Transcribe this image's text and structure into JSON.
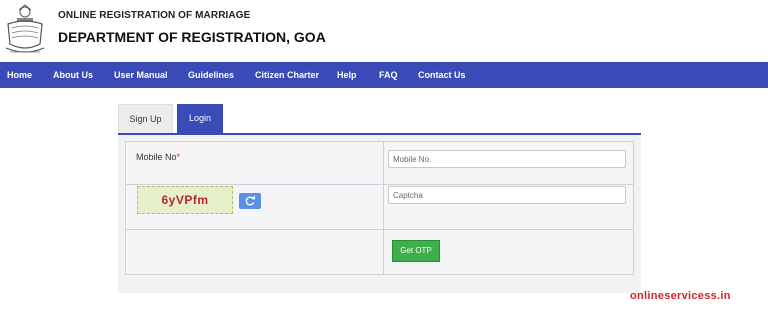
{
  "header": {
    "subtitle": "ONLINE REGISTRATION OF MARRIAGE",
    "title": "DEPARTMENT OF REGISTRATION, GOA",
    "emblem_icon": "goa-emblem-icon"
  },
  "nav": {
    "items": [
      "Home",
      "About Us",
      "User Manual",
      "Guidelines",
      "Citizen Charter",
      "Help",
      "FAQ",
      "Contact Us"
    ],
    "color": "#3a4ab6"
  },
  "tabs": {
    "signup": "Sign Up",
    "login": "Login",
    "active": "Login"
  },
  "form": {
    "mobile_label": "Mobile No",
    "required_mark": "*",
    "mobile_placeholder": "Mobile No.",
    "captcha_text": "6yVPfm",
    "captcha_placeholder": "Captcha",
    "refresh_icon": "refresh-icon",
    "submit_label": "Get OTP",
    "submit_color": "#3db04b"
  },
  "watermark": "onlineservicess.in"
}
